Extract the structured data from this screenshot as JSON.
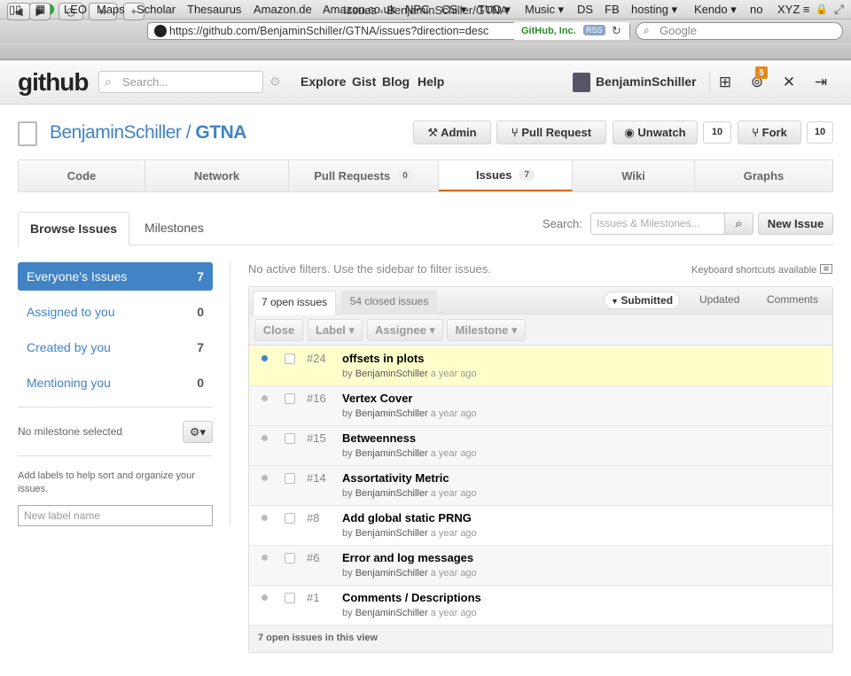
{
  "browser": {
    "window_title": "Issues · BenjaminSchiller/GTNA",
    "url": "https://github.com/BenjaminSchiller/GTNA/issues?direction=desc",
    "site_identity": "GitHub, Inc.",
    "rss_label": "RSS",
    "search_placeholder": "Google",
    "bookmarks": [
      "LEO",
      "Maps",
      "Scholar",
      "Thesaurus",
      "Amazon.de",
      "Amazon.co.uk",
      "NPC",
      "CS ▾",
      "TUD ▾",
      "Music ▾",
      "DS",
      "FB",
      "hosting ▾",
      "Kendo ▾",
      "no",
      "XYZ ≡"
    ]
  },
  "gh_header": {
    "logo": "github",
    "search_placeholder": "Search...",
    "nav": [
      "Explore",
      "Gist",
      "Blog",
      "Help"
    ],
    "username": "BenjaminSchiller",
    "notification_count": "5"
  },
  "repo": {
    "owner": "BenjaminSchiller",
    "separator": " / ",
    "name": "GTNA",
    "admin_label": "Admin",
    "pull_request_label": "Pull Request",
    "unwatch_label": "Unwatch",
    "watch_count": "10",
    "fork_label": "Fork",
    "fork_count": "10"
  },
  "tabs": [
    {
      "label": "Code",
      "count": ""
    },
    {
      "label": "Network",
      "count": ""
    },
    {
      "label": "Pull Requests",
      "count": "0"
    },
    {
      "label": "Issues",
      "count": "7"
    },
    {
      "label": "Wiki",
      "count": ""
    },
    {
      "label": "Graphs",
      "count": ""
    }
  ],
  "subnav": {
    "browse": "Browse Issues",
    "milestones": "Milestones",
    "search_label": "Search:",
    "search_placeholder": "Issues & Milestones...",
    "new_issue": "New Issue"
  },
  "sidebar": {
    "filters": [
      {
        "label": "Everyone’s Issues",
        "count": "7"
      },
      {
        "label": "Assigned to you",
        "count": "0"
      },
      {
        "label": "Created by you",
        "count": "7"
      },
      {
        "label": "Mentioning you",
        "count": "0"
      }
    ],
    "no_milestone": "No milestone selected",
    "labels_help": "Add labels to help sort and organize your issues.",
    "label_placeholder": "New label name"
  },
  "issues_panel": {
    "filter_note": "No active filters. Use the sidebar to filter issues.",
    "keyboard_note": "Keyboard shortcuts available",
    "open_tab": "7 open issues",
    "closed_tab": "54 closed issues",
    "sort_submitted": "Submitted",
    "sort_updated": "Updated",
    "sort_comments": "Comments",
    "actions": [
      "Close",
      "Label ▾",
      "Assignee ▾",
      "Milestone ▾"
    ],
    "footer": "7 open issues in this view",
    "items": [
      {
        "number": "#24",
        "title": "offsets in plots",
        "by": "by",
        "author": "BenjaminSchiller",
        "time": "a year ago"
      },
      {
        "number": "#16",
        "title": "Vertex Cover",
        "by": "by",
        "author": "BenjaminSchiller",
        "time": "a year ago"
      },
      {
        "number": "#15",
        "title": "Betweenness",
        "by": "by",
        "author": "BenjaminSchiller",
        "time": "a year ago"
      },
      {
        "number": "#14",
        "title": "Assortativity Metric",
        "by": "by",
        "author": "BenjaminSchiller",
        "time": "a year ago"
      },
      {
        "number": "#8",
        "title": "Add global static PRNG",
        "by": "by",
        "author": "BenjaminSchiller",
        "time": "a year ago"
      },
      {
        "number": "#6",
        "title": "Error and log messages",
        "by": "by",
        "author": "BenjaminSchiller",
        "time": "a year ago"
      },
      {
        "number": "#1",
        "title": "Comments / Descriptions",
        "by": "by",
        "author": "BenjaminSchiller",
        "time": "a year ago"
      }
    ]
  }
}
